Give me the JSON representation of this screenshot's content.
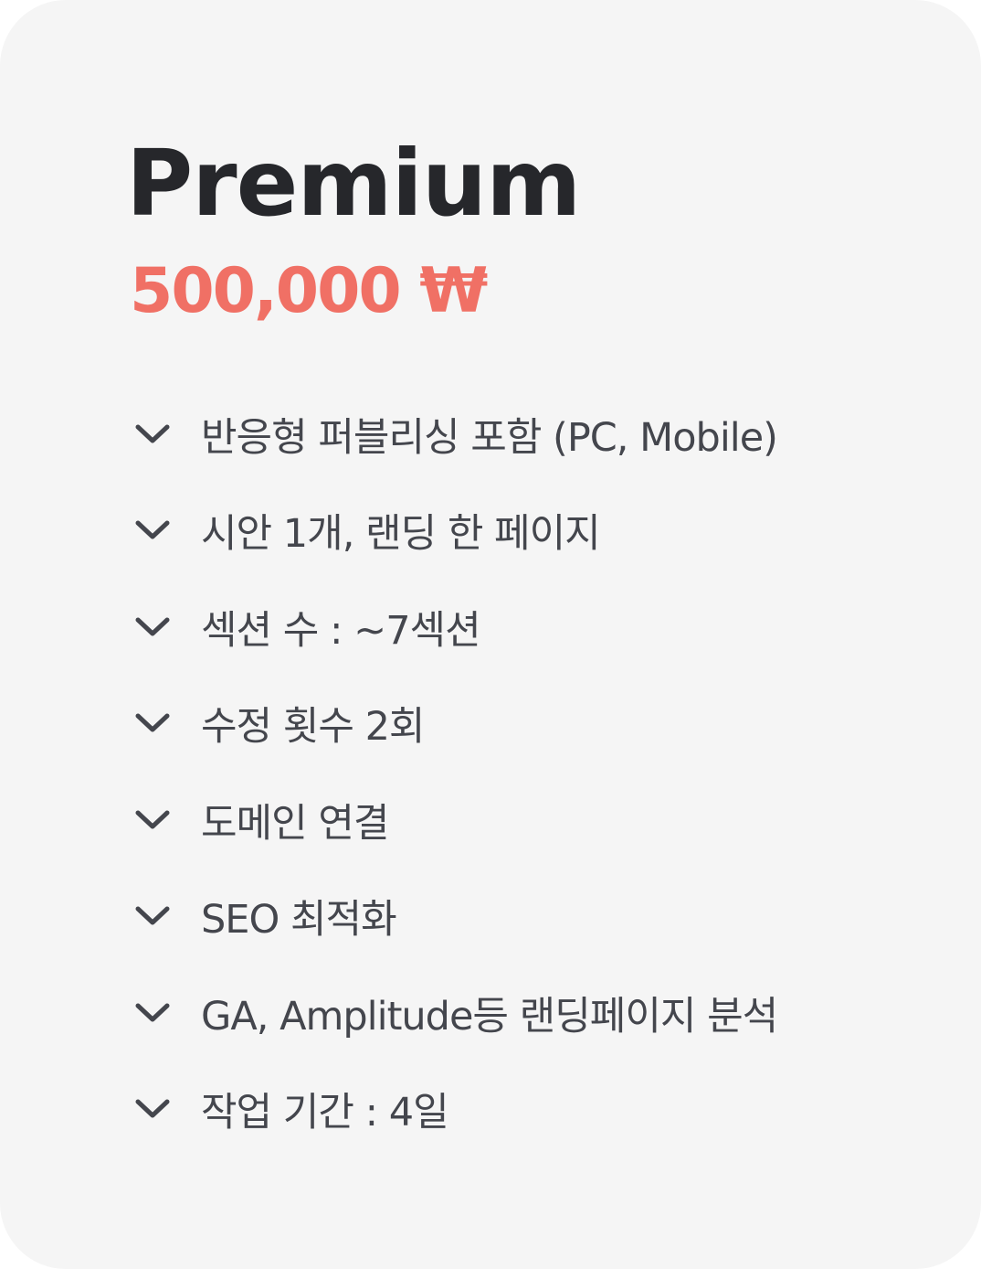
{
  "plan": {
    "name": "Premium",
    "price": "500,000 ₩"
  },
  "colors": {
    "card_background": "#f5f5f5",
    "title": "#26272b",
    "price_accent": "#f07065",
    "feature_text": "#44464d",
    "check_icon": "#44464d"
  },
  "icons": {
    "feature_marker": "chevron-down-icon"
  },
  "features": [
    "반응형 퍼블리싱 포함 (PC, Mobile)",
    "시안 1개, 랜딩 한 페이지",
    "섹션 수 : ~7섹션",
    "수정 횟수 2회",
    "도메인 연결",
    "SEO 최적화",
    "GA, Amplitude등 랜딩페이지 분석",
    "작업 기간 : 4일"
  ]
}
